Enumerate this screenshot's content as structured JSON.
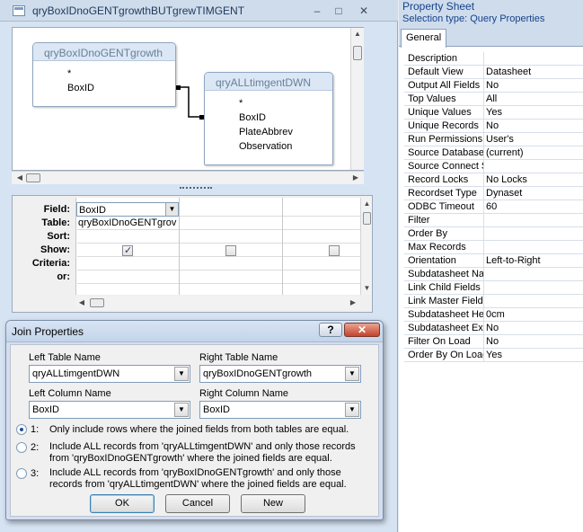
{
  "query_window": {
    "title": "qryBoxIDnoGENTgrowthBUTgrewTIMGENT",
    "table1": {
      "name": "qryBoxIDnoGENTgrowth",
      "fields": [
        "*",
        "BoxID"
      ]
    },
    "table2": {
      "name": "qryALLtimgentDWN",
      "fields": [
        "*",
        "BoxID",
        "PlateAbbrev",
        "Observation"
      ]
    },
    "grid": {
      "row_labels": [
        "Field:",
        "Table:",
        "Sort:",
        "Show:",
        "Criteria:",
        "or:"
      ],
      "col1_field": "BoxID",
      "col1_table": "qryBoxIDnoGENTgrov",
      "col1_show": true,
      "col2_show": false,
      "col3_show": false
    }
  },
  "join_dialog": {
    "title": "Join Properties",
    "left_table_label": "Left Table Name",
    "left_table_value": "qryALLtimgentDWN",
    "right_table_label": "Right Table Name",
    "right_table_value": "qryBoxIDnoGENTgrowth",
    "left_column_label": "Left Column Name",
    "left_column_value": "BoxID",
    "right_column_label": "Right Column Name",
    "right_column_value": "BoxID",
    "options": [
      {
        "num": "1:",
        "text": "Only include rows where the joined fields from both tables are equal.",
        "selected": true
      },
      {
        "num": "2:",
        "text": "Include ALL records from 'qryALLtimgentDWN' and only those records from 'qryBoxIDnoGENTgrowth' where the joined fields are equal.",
        "selected": false
      },
      {
        "num": "3:",
        "text": "Include ALL records from 'qryBoxIDnoGENTgrowth' and only those records from 'qryALLtimgentDWN' where the joined fields are equal.",
        "selected": false
      }
    ],
    "ok": "OK",
    "cancel": "Cancel",
    "new": "New",
    "help": "?",
    "close": "✕"
  },
  "property_sheet": {
    "title": "Property Sheet",
    "selection_type": "Selection type:  Query Properties",
    "tab": "General",
    "rows": [
      {
        "name": "Description",
        "value": ""
      },
      {
        "name": "Default View",
        "value": "Datasheet"
      },
      {
        "name": "Output All Fields",
        "value": "No"
      },
      {
        "name": "Top Values",
        "value": "All"
      },
      {
        "name": "Unique Values",
        "value": "Yes"
      },
      {
        "name": "Unique Records",
        "value": "No"
      },
      {
        "name": "Run Permissions",
        "value": "User's"
      },
      {
        "name": "Source Database",
        "value": "(current)"
      },
      {
        "name": "Source Connect Str",
        "value": ""
      },
      {
        "name": "Record Locks",
        "value": "No Locks"
      },
      {
        "name": "Recordset Type",
        "value": "Dynaset"
      },
      {
        "name": "ODBC Timeout",
        "value": "60"
      },
      {
        "name": "Filter",
        "value": ""
      },
      {
        "name": "Order By",
        "value": ""
      },
      {
        "name": "Max Records",
        "value": ""
      },
      {
        "name": "Orientation",
        "value": "Left-to-Right"
      },
      {
        "name": "Subdatasheet Name",
        "value": ""
      },
      {
        "name": "Link Child Fields",
        "value": ""
      },
      {
        "name": "Link Master Fields",
        "value": ""
      },
      {
        "name": "Subdatasheet Height",
        "value": "0cm"
      },
      {
        "name": "Subdatasheet Expanded",
        "value": "No"
      },
      {
        "name": "Filter On Load",
        "value": "No"
      },
      {
        "name": "Order By On Load",
        "value": "Yes"
      }
    ]
  },
  "icons": {
    "minimize": "minimize-icon",
    "maximize": "maximize-icon",
    "close": "close-icon",
    "dropdown": "chevron-down-icon",
    "check": "checkmark-icon"
  }
}
